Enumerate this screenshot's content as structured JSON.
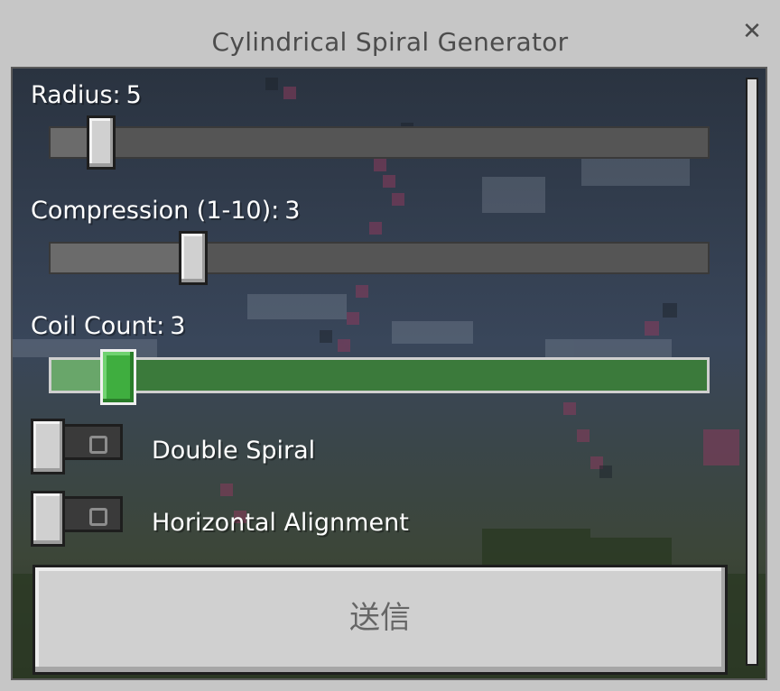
{
  "window": {
    "title": "Cylindrical Spiral Generator",
    "close_icon": "close-icon"
  },
  "sliders": [
    {
      "label": "Radius:",
      "value": "5",
      "position_fraction": 0.08,
      "active": false
    },
    {
      "label": "Compression (1-10):",
      "value": "3",
      "position_fraction": 0.22,
      "active": false
    },
    {
      "label": "Coil Count:",
      "value": "3",
      "position_fraction": 0.1,
      "active": true
    }
  ],
  "toggles": [
    {
      "label": "Double Spiral",
      "state": "off"
    },
    {
      "label": "Horizontal Alignment",
      "state": "off"
    }
  ],
  "submit": {
    "label": "送信"
  },
  "colors": {
    "active_track": "#3b7a3b",
    "active_knob": "#3fae3f",
    "panel_background": "#2f3843",
    "window_background": "#c6c6c6"
  }
}
